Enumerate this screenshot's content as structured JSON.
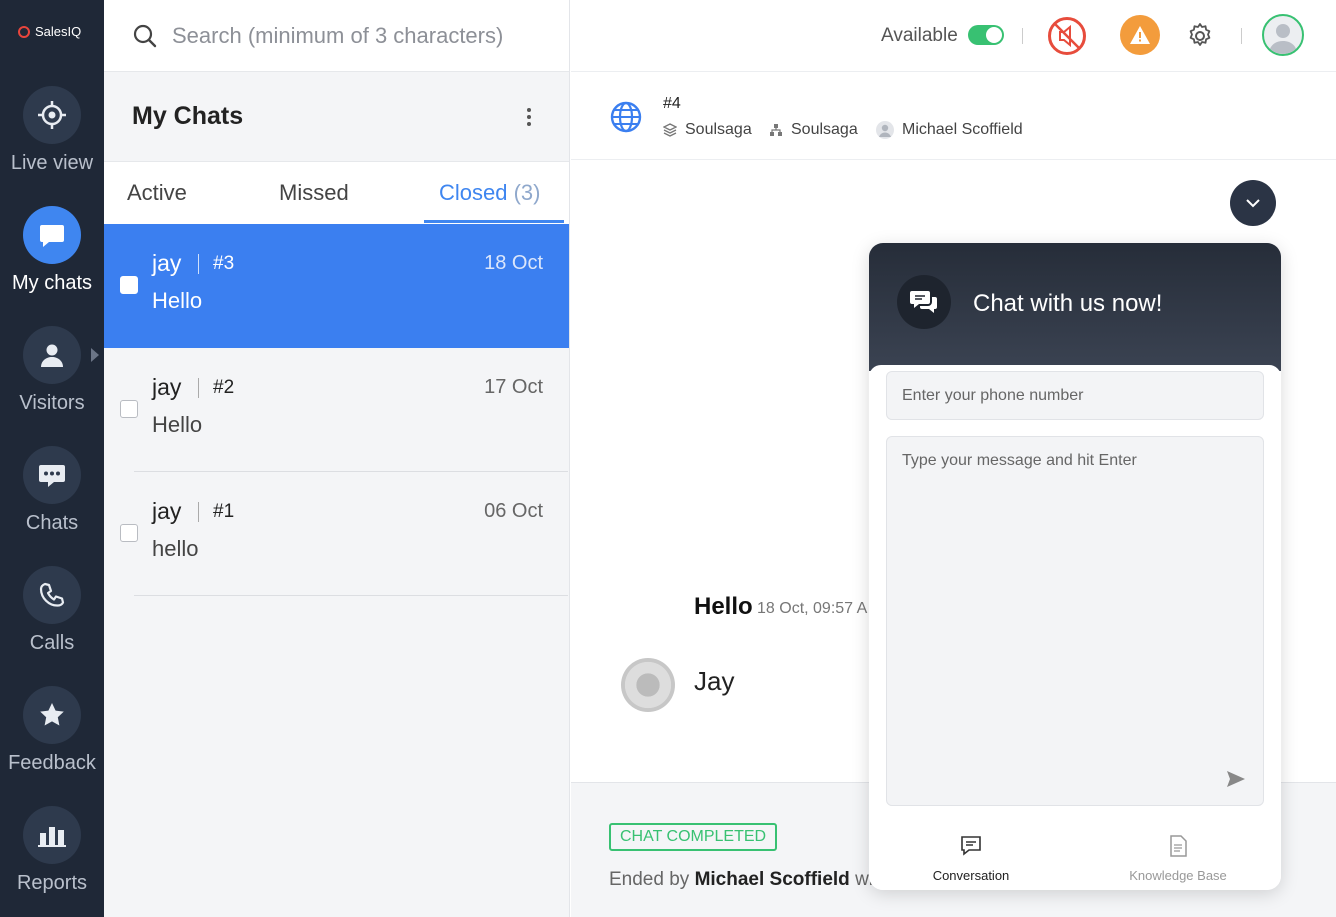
{
  "brand": "SalesIQ",
  "rail": [
    {
      "label": "Live view",
      "icon": "crosshair-icon"
    },
    {
      "label": "My chats",
      "icon": "chat-bubble-icon",
      "active": true
    },
    {
      "label": "Visitors",
      "icon": "person-icon"
    },
    {
      "label": "Chats",
      "icon": "chat-dots-icon"
    },
    {
      "label": "Calls",
      "icon": "phone-icon"
    },
    {
      "label": "Feedback",
      "icon": "star-icon"
    },
    {
      "label": "Reports",
      "icon": "bar-chart-icon"
    }
  ],
  "search": {
    "placeholder": "Search (minimum of 3 characters)"
  },
  "mychats": {
    "title": "My Chats"
  },
  "tabs": {
    "active": "Active",
    "missed": "Missed",
    "closed": "Closed",
    "closed_count": "(3)"
  },
  "chats": [
    {
      "name": "jay",
      "num": "#3",
      "date": "18 Oct",
      "msg": "Hello"
    },
    {
      "name": "jay",
      "num": "#2",
      "date": "17 Oct",
      "msg": "Hello"
    },
    {
      "name": "jay",
      "num": "#1",
      "date": "06 Oct",
      "msg": "hello"
    }
  ],
  "topbar": {
    "status": "Available"
  },
  "chat_header": {
    "number": "#4",
    "brand1": "Soulsaga",
    "brand2": "Soulsaga",
    "agent": "Michael Scoffield"
  },
  "conversation": {
    "message": "Hello",
    "time": "18 Oct, 09:57 A",
    "visitor": "Jay"
  },
  "footer": {
    "status": "CHAT COMPLETED",
    "ended_prefix": "Ended by",
    "ended_by": "Michael Scoffield",
    "ended_suffix": "wh"
  },
  "widget": {
    "title": "Chat with us now!",
    "phone_placeholder": "Enter your phone number",
    "message_placeholder": "Type your message and hit Enter",
    "tab_conversation": "Conversation",
    "tab_kb": "Knowledge Base"
  },
  "colors": {
    "accent": "#3b7ff0",
    "rail": "#1f2837",
    "success": "#38c172",
    "warning": "#f39c3c",
    "danger": "#e74c3c"
  }
}
